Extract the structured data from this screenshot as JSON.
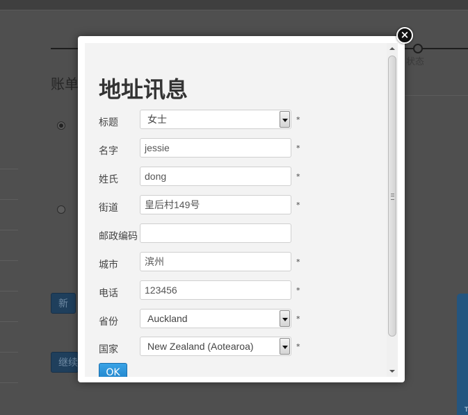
{
  "background": {
    "step_label": "状态",
    "section_heading": "账单",
    "new_button": "新",
    "continue_button": "继续",
    "side_panel_text": "T"
  },
  "modal": {
    "title": "地址讯息",
    "required_mark": "*",
    "close_icon_glyph": "×",
    "fields": {
      "salutation": {
        "label": "标题",
        "value": "女士"
      },
      "first_name": {
        "label": "名字",
        "value": "jessie"
      },
      "last_name": {
        "label": "姓氏",
        "value": "dong"
      },
      "street": {
        "label": "街道",
        "value": "皇后村149号"
      },
      "postcode": {
        "label": "邮政编码",
        "value": ""
      },
      "city": {
        "label": "城市",
        "value": "滨州"
      },
      "phone": {
        "label": "电话",
        "value": "123456"
      },
      "province": {
        "label": "省份",
        "value": "Auckland"
      },
      "country": {
        "label": "国家",
        "value": "New Zealand (Aotearoa)"
      }
    },
    "ok_button": "OK"
  },
  "colors": {
    "overlay": "#4f4f4f",
    "modal_background": "#f3f3f3",
    "ok_button": "#2a8fd6",
    "close_button": "#111111"
  }
}
